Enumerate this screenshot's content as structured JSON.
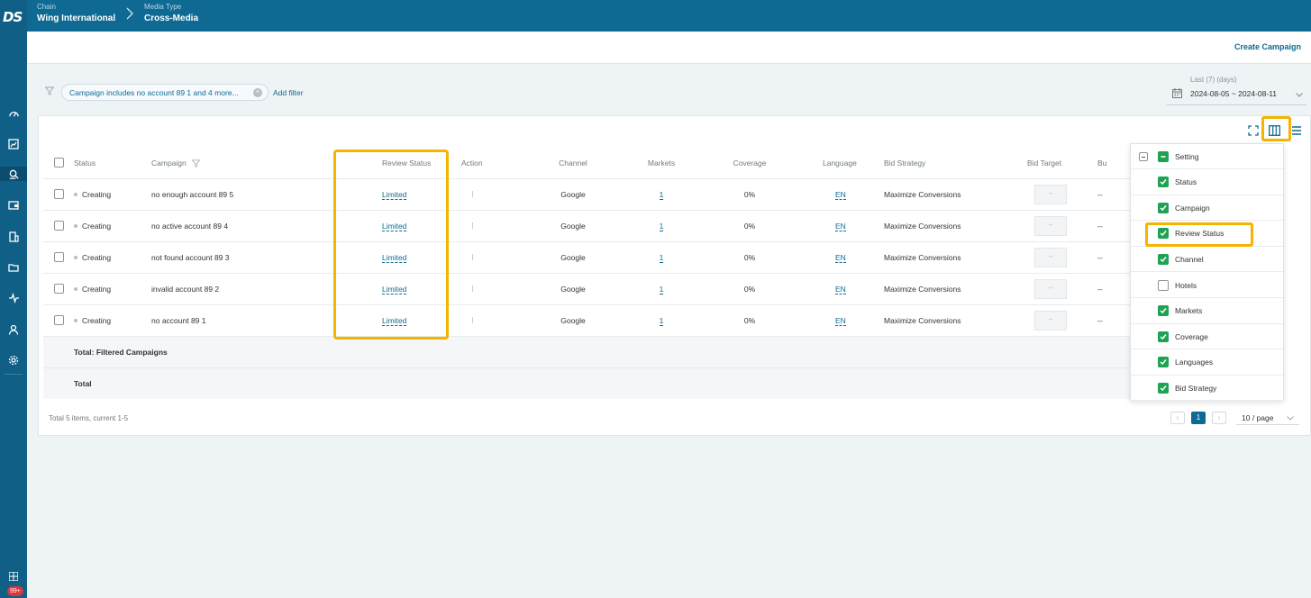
{
  "brand": {
    "logo_text": "DS",
    "badge": "99+"
  },
  "breadcrumb": [
    {
      "key": "Chain",
      "value": "Wing International"
    },
    {
      "key": "Media Type",
      "value": "Cross-Media"
    }
  ],
  "actions": {
    "create_campaign": "Create Campaign"
  },
  "filter": {
    "chip_text": "Campaign includes no account 89 1 and 4 more...",
    "add_filter": "Add filter"
  },
  "date_range": {
    "label": "Last (7) (days)",
    "value": "2024-08-05 ~ 2024-08-11"
  },
  "table": {
    "columns": [
      "Status",
      "Campaign",
      "Review Status",
      "Action",
      "Channel",
      "Markets",
      "Coverage",
      "Language",
      "Bid Strategy",
      "Bid Target",
      "Bu"
    ],
    "rows": [
      {
        "status": "Creating",
        "campaign": "no enough account 89 5",
        "review": "Limited",
        "channel": "Google",
        "markets": "1",
        "coverage": "0%",
        "language": "EN",
        "bid_strategy": "Maximize Conversions",
        "bid_target": "--"
      },
      {
        "status": "Creating",
        "campaign": "no active account 89 4",
        "review": "Limited",
        "channel": "Google",
        "markets": "1",
        "coverage": "0%",
        "language": "EN",
        "bid_strategy": "Maximize Conversions",
        "bid_target": "--"
      },
      {
        "status": "Creating",
        "campaign": "not found account 89 3",
        "review": "Limited",
        "channel": "Google",
        "markets": "1",
        "coverage": "0%",
        "language": "EN",
        "bid_strategy": "Maximize Conversions",
        "bid_target": "--"
      },
      {
        "status": "Creating",
        "campaign": "invalid account 89 2",
        "review": "Limited",
        "channel": "Google",
        "markets": "1",
        "coverage": "0%",
        "language": "EN",
        "bid_strategy": "Maximize Conversions",
        "bid_target": "--"
      },
      {
        "status": "Creating",
        "campaign": "no account 89 1",
        "review": "Limited",
        "channel": "Google",
        "markets": "1",
        "coverage": "0%",
        "language": "EN",
        "bid_strategy": "Maximize Conversions",
        "bid_target": "--"
      }
    ],
    "totals": [
      "Total: Filtered Campaigns",
      "Total"
    ],
    "trailing_cell": "--"
  },
  "pagination": {
    "info": "Total 5 items, current 1-5",
    "current_page": "1",
    "page_size": "10 / page"
  },
  "column_settings": {
    "items": [
      {
        "label": "Setting",
        "state": "partial"
      },
      {
        "label": "Status",
        "state": "checked"
      },
      {
        "label": "Campaign",
        "state": "checked"
      },
      {
        "label": "Review Status",
        "state": "checked"
      },
      {
        "label": "Channel",
        "state": "checked"
      },
      {
        "label": "Hotels",
        "state": "unchecked"
      },
      {
        "label": "Markets",
        "state": "checked"
      },
      {
        "label": "Coverage",
        "state": "checked"
      },
      {
        "label": "Languages",
        "state": "checked"
      },
      {
        "label": "Bid Strategy",
        "state": "checked"
      }
    ]
  },
  "colors": {
    "primary": "#0f6a93",
    "rail": "#0f5f86",
    "highlight": "#f5b400",
    "check": "#1fa254"
  }
}
